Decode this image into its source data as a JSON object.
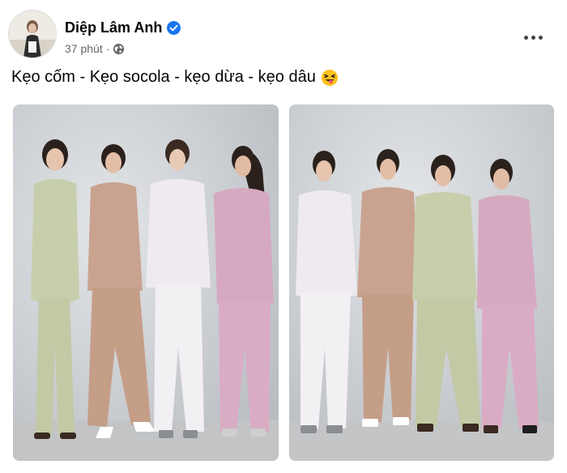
{
  "post": {
    "author_name": "Diệp Lâm Anh",
    "timestamp": "37 phút",
    "separator": "·",
    "privacy_icon": "globe-icon",
    "verified_icon": "verified-badge-icon",
    "more_icon": "more-options-icon",
    "caption_text": "Kẹo cốm - Kẹo socola - kẹo dừa - kẹo dâu",
    "caption_emoji": "squinting-face-with-tongue-emoji"
  },
  "colors": {
    "verified_blue": "#1877f2",
    "meta_gray": "#65676b",
    "suit_green": "#c7ceac",
    "suit_tan": "#c9a38f",
    "suit_white": "#eeeaf0",
    "suit_pink": "#d6a9c0"
  },
  "photos": [
    {
      "kind": "photo",
      "subject": "four women in pastel suits",
      "order": [
        "green",
        "tan",
        "white",
        "pink"
      ]
    },
    {
      "kind": "photo",
      "subject": "four women in pastel suits",
      "order": [
        "white",
        "tan",
        "green",
        "pink"
      ]
    }
  ]
}
